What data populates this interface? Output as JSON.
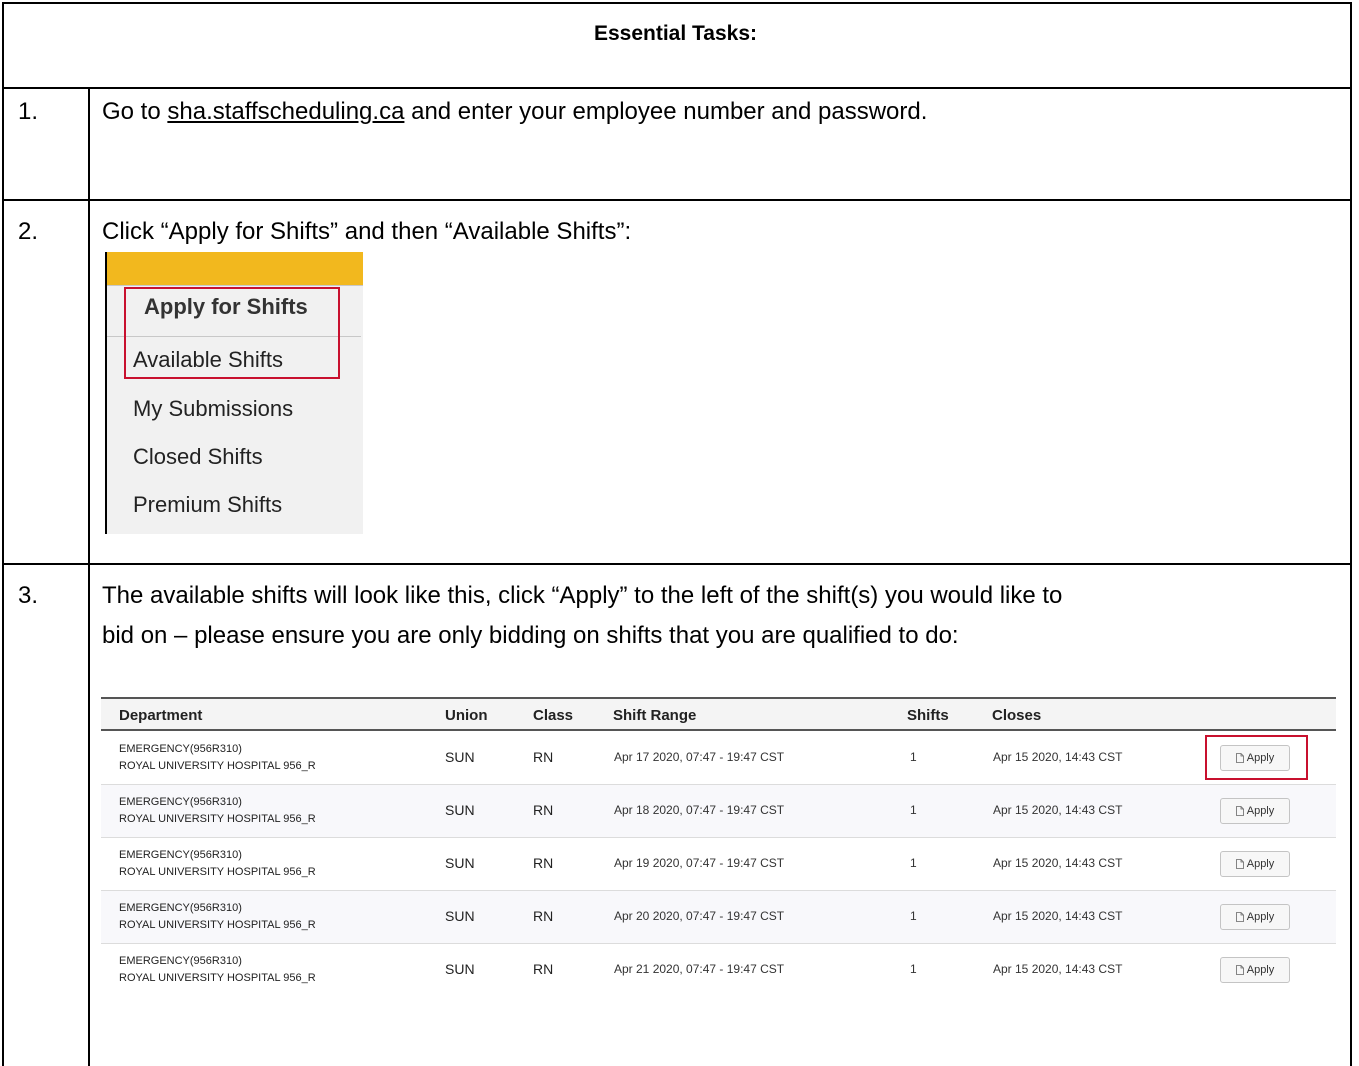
{
  "heading": "Essential Tasks:",
  "steps": [
    {
      "num": "1.",
      "text_before": "Go to ",
      "link": "sha.staffscheduling.ca",
      "text_after": " and enter your employee number and password."
    },
    {
      "num": "2.",
      "text": "Click “Apply for Shifts” and then “Available Shifts”:"
    },
    {
      "num": "3.",
      "line1": "The available shifts will look like this, click “Apply” to the left of the shift(s) you would like to",
      "line2": "bid on – please ensure you are only bidding on shifts that you are qualified to do:"
    }
  ],
  "menu": {
    "header": "Apply for Shifts",
    "items": [
      "Available Shifts",
      "My Submissions",
      "Closed Shifts",
      "Premium Shifts"
    ],
    "bar_color": "#f2b81e",
    "highlight_color": "#c8102e"
  },
  "shifts_table": {
    "columns": [
      "Department",
      "Union",
      "Class",
      "Shift Range",
      "Shifts",
      "Closes"
    ],
    "button_label": "Apply",
    "rows": [
      {
        "dept_line1": "EMERGENCY(956R310)",
        "dept_line2": "ROYAL UNIVERSITY HOSPITAL 956_R",
        "union": "SUN",
        "class": "RN",
        "range": "Apr 17 2020, 07:47 - 19:47 CST",
        "shifts": "1",
        "closes": "Apr 15 2020, 14:43 CST"
      },
      {
        "dept_line1": "EMERGENCY(956R310)",
        "dept_line2": "ROYAL UNIVERSITY HOSPITAL 956_R",
        "union": "SUN",
        "class": "RN",
        "range": "Apr 18 2020, 07:47 - 19:47 CST",
        "shifts": "1",
        "closes": "Apr 15 2020, 14:43 CST"
      },
      {
        "dept_line1": "EMERGENCY(956R310)",
        "dept_line2": "ROYAL UNIVERSITY HOSPITAL 956_R",
        "union": "SUN",
        "class": "RN",
        "range": "Apr 19 2020, 07:47 - 19:47 CST",
        "shifts": "1",
        "closes": "Apr 15 2020, 14:43 CST"
      },
      {
        "dept_line1": "EMERGENCY(956R310)",
        "dept_line2": "ROYAL UNIVERSITY HOSPITAL 956_R",
        "union": "SUN",
        "class": "RN",
        "range": "Apr 20 2020, 07:47 - 19:47 CST",
        "shifts": "1",
        "closes": "Apr 15 2020, 14:43 CST"
      },
      {
        "dept_line1": "EMERGENCY(956R310)",
        "dept_line2": "ROYAL UNIVERSITY HOSPITAL 956_R",
        "union": "SUN",
        "class": "RN",
        "range": "Apr 21 2020, 07:47 - 19:47 CST",
        "shifts": "1",
        "closes": "Apr 15 2020, 14:43 CST"
      }
    ]
  }
}
